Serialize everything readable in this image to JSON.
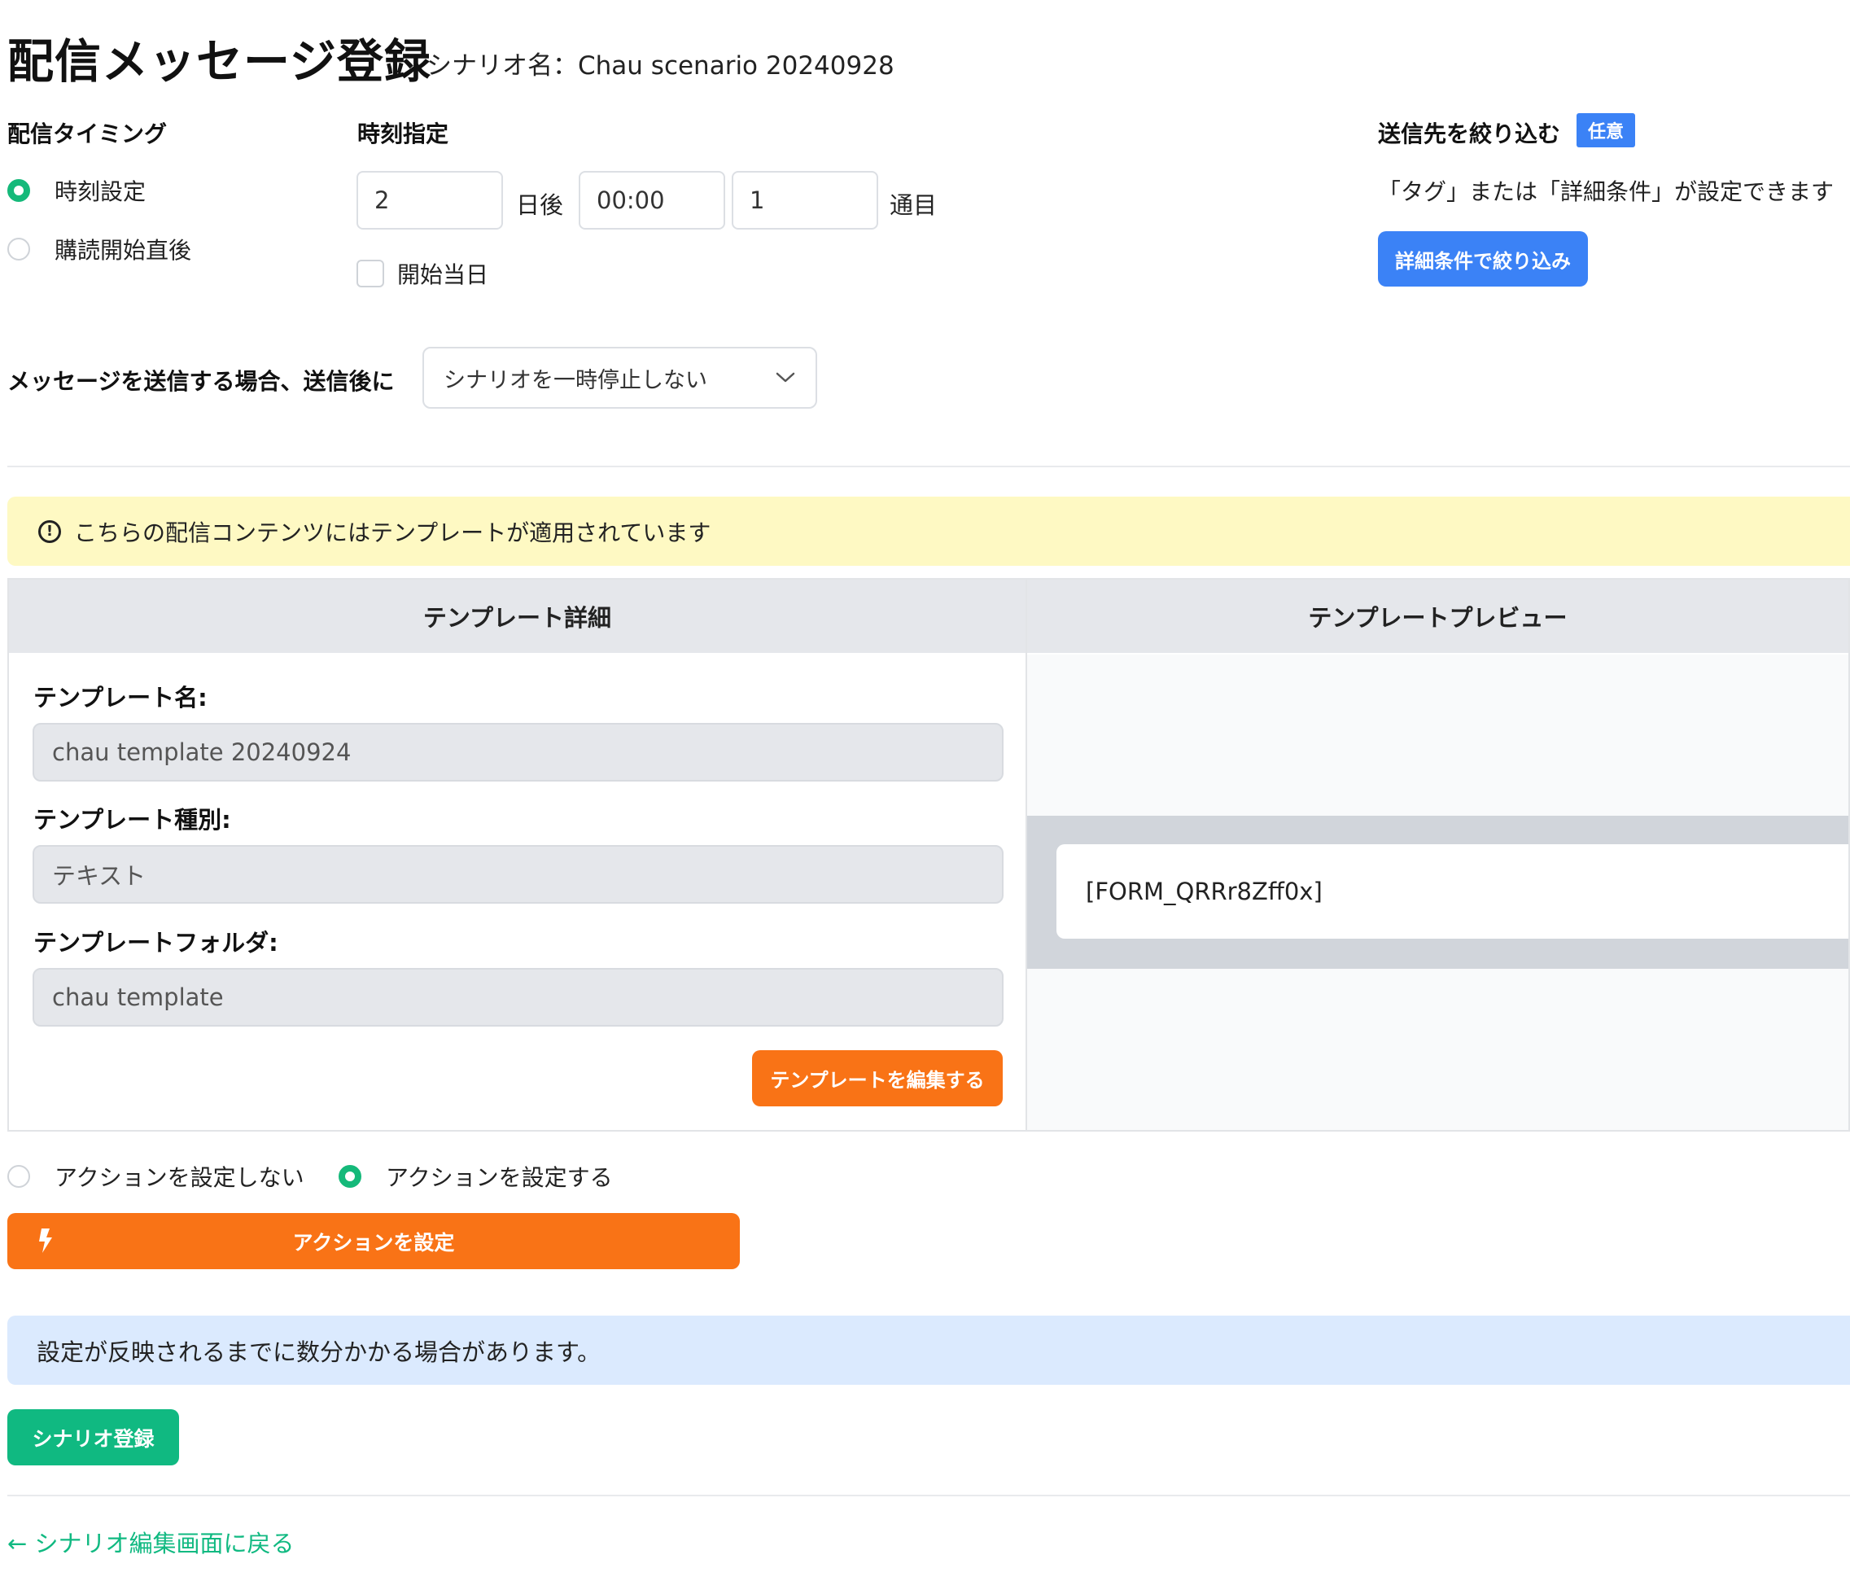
{
  "header": {
    "title": "配信メッセージ登録",
    "scenario_name": "シナリオ名：Chau scenario 20240928"
  },
  "timing": {
    "label": "配信タイミング",
    "options": [
      {
        "label": "時刻設定",
        "selected": true
      },
      {
        "label": "購読開始直後",
        "selected": false
      }
    ]
  },
  "time_spec": {
    "label": "時刻指定",
    "days_value": "2",
    "days_suffix": "日後",
    "time_value": "00:00",
    "count_value": "1",
    "count_suffix": "通目",
    "start_day_label": "開始当日",
    "start_day_checked": false
  },
  "filter": {
    "label": "送信先を絞り込む",
    "badge": "任意",
    "description": "「タグ」または「詳細条件」が設定できます",
    "button_label": "詳細条件で絞り込み"
  },
  "after_send": {
    "label": "メッセージを送信する場合、送信後に",
    "selected": "シナリオを一時停止しない"
  },
  "template_notice": "こちらの配信コンテンツにはテンプレートが適用されています",
  "template_panel": {
    "detail_header": "テンプレート詳細",
    "preview_header": "テンプレートプレビュー",
    "name_label": "テンプレート名:",
    "name_value": "chau template 20240924",
    "type_label": "テンプレート種別:",
    "type_value": "テキスト",
    "folder_label": "テンプレートフォルダ:",
    "folder_value": "chau template",
    "edit_button": "テンプレートを編集する",
    "preview_text": "[FORM_QRRr8Zff0x]"
  },
  "action": {
    "options": [
      {
        "label": "アクションを設定しない",
        "selected": false
      },
      {
        "label": "アクションを設定する",
        "selected": true
      }
    ],
    "button_label": "アクションを設定"
  },
  "info_notice": "設定が反映されるまでに数分かかる場合があります。",
  "submit_button": "シナリオ登録",
  "back_link": "← シナリオ編集画面に戻る",
  "colors": {
    "primary_green": "#10b981",
    "accent_blue": "#3b82f6",
    "accent_orange": "#f97316",
    "warning_bg": "#fef9c3",
    "info_bg": "#dbeafe"
  }
}
